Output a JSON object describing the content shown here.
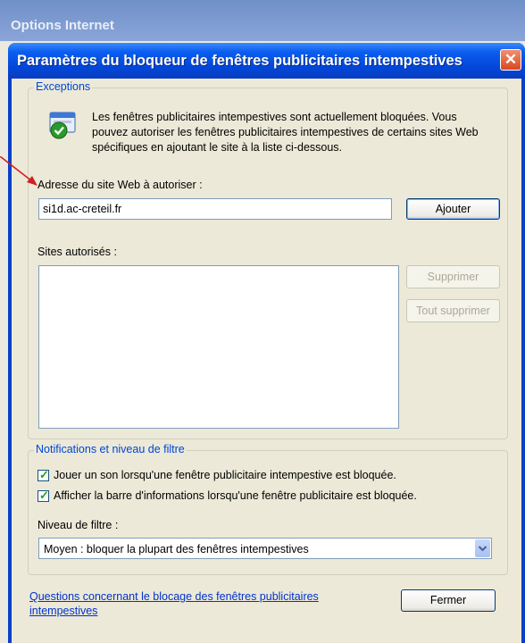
{
  "background_window": {
    "title": "Options Internet"
  },
  "dialog": {
    "title": "Paramètres du bloqueur de fenêtres publicitaires intempestives",
    "exceptions": {
      "group_label": "Exceptions",
      "info_text": "Les fenêtres publicitaires intempestives sont actuellement bloquées. Vous pouvez autoriser les fenêtres publicitaires intempestives de certains sites Web spécifiques en ajoutant le site à la liste ci-dessous.",
      "address_label": "Adresse du site Web à autoriser :",
      "address_value": "si1d.ac-creteil.fr",
      "add_button": "Ajouter",
      "allowed_sites_label": "Sites autorisés :",
      "allowed_sites": [],
      "remove_button": "Supprimer",
      "remove_all_button": "Tout supprimer"
    },
    "notifications": {
      "group_label": "Notifications et niveau de filtre",
      "play_sound_label": "Jouer un son lorsqu'une fenêtre publicitaire intempestive est bloquée.",
      "play_sound_checked": true,
      "show_infobar_label": "Afficher la barre d'informations lorsqu'une fenêtre publicitaire est bloquée.",
      "show_infobar_checked": true,
      "filter_level_label": "Niveau de filtre :",
      "filter_level_value": "Moyen : bloquer la plupart des fenêtres intempestives"
    },
    "help_link": "Questions concernant le blocage des fenêtres publicitaires intempestives",
    "close_button": "Fermer"
  },
  "colors": {
    "title_bar": "#0b5ef0",
    "group_label": "#0046d5",
    "dialog_face": "#ece9d8",
    "annotation_arrow": "#d02020",
    "checkmark": "#21a121"
  },
  "icons": {
    "info": "popup-blocker-shield-icon",
    "close": "close-x-icon",
    "dropdown": "chevron-down-icon"
  }
}
